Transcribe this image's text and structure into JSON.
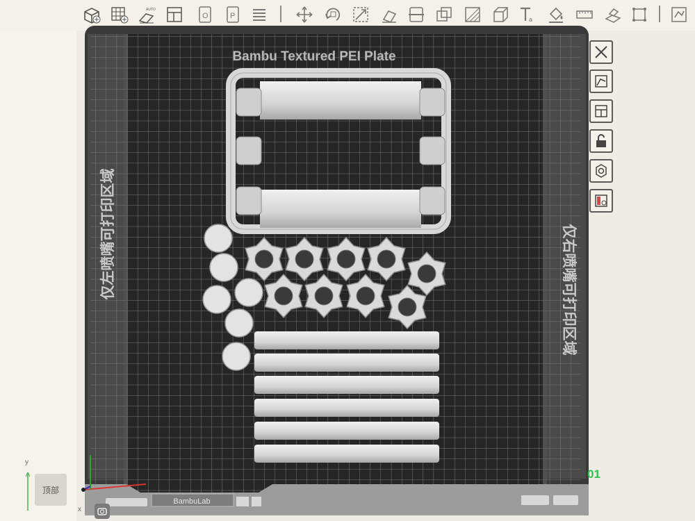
{
  "toolbar": {
    "tools": [
      {
        "name": "add-object-icon"
      },
      {
        "name": "add-plate-icon"
      },
      {
        "name": "auto-orient-icon",
        "label": "AUTO"
      },
      {
        "name": "arrange-icon"
      },
      {
        "name": "split-objects-icon"
      },
      {
        "name": "split-parts-icon"
      },
      {
        "name": "layers-icon"
      },
      {
        "name": "move-icon"
      },
      {
        "name": "rotate-icon"
      },
      {
        "name": "scale-icon"
      },
      {
        "name": "lay-on-face-icon"
      },
      {
        "name": "cut-icon"
      },
      {
        "name": "boolean-icon"
      },
      {
        "name": "support-paint-icon"
      },
      {
        "name": "seam-paint-icon"
      },
      {
        "name": "text-icon"
      },
      {
        "name": "color-paint-icon"
      },
      {
        "name": "measure-icon"
      },
      {
        "name": "assembly-icon"
      },
      {
        "name": "fit-view-icon"
      },
      {
        "name": "variable-layer-icon"
      }
    ]
  },
  "plate": {
    "title": "Bambu Textured PEI Plate",
    "left_zone": "仅左喷嘴可打印区域",
    "right_zone": "仅右喷嘴可打印区域",
    "brand": "BambuLab",
    "number": "01"
  },
  "view": {
    "cube_label": "顶部",
    "axis_y": "y",
    "axis_x": "x"
  },
  "side_buttons": [
    {
      "name": "close-plate-button"
    },
    {
      "name": "auto-orient-plate-button"
    },
    {
      "name": "arrange-plate-button"
    },
    {
      "name": "lock-plate-button"
    },
    {
      "name": "plate-settings-button"
    },
    {
      "name": "plate-filament-button"
    }
  ],
  "colors": {
    "plate_dark": "#2c2c2c",
    "plate_frame": "#9a9a9a",
    "grid": "#7d7d7d",
    "model": "#dcdcdc",
    "accent_green": "#2fbf4a"
  }
}
